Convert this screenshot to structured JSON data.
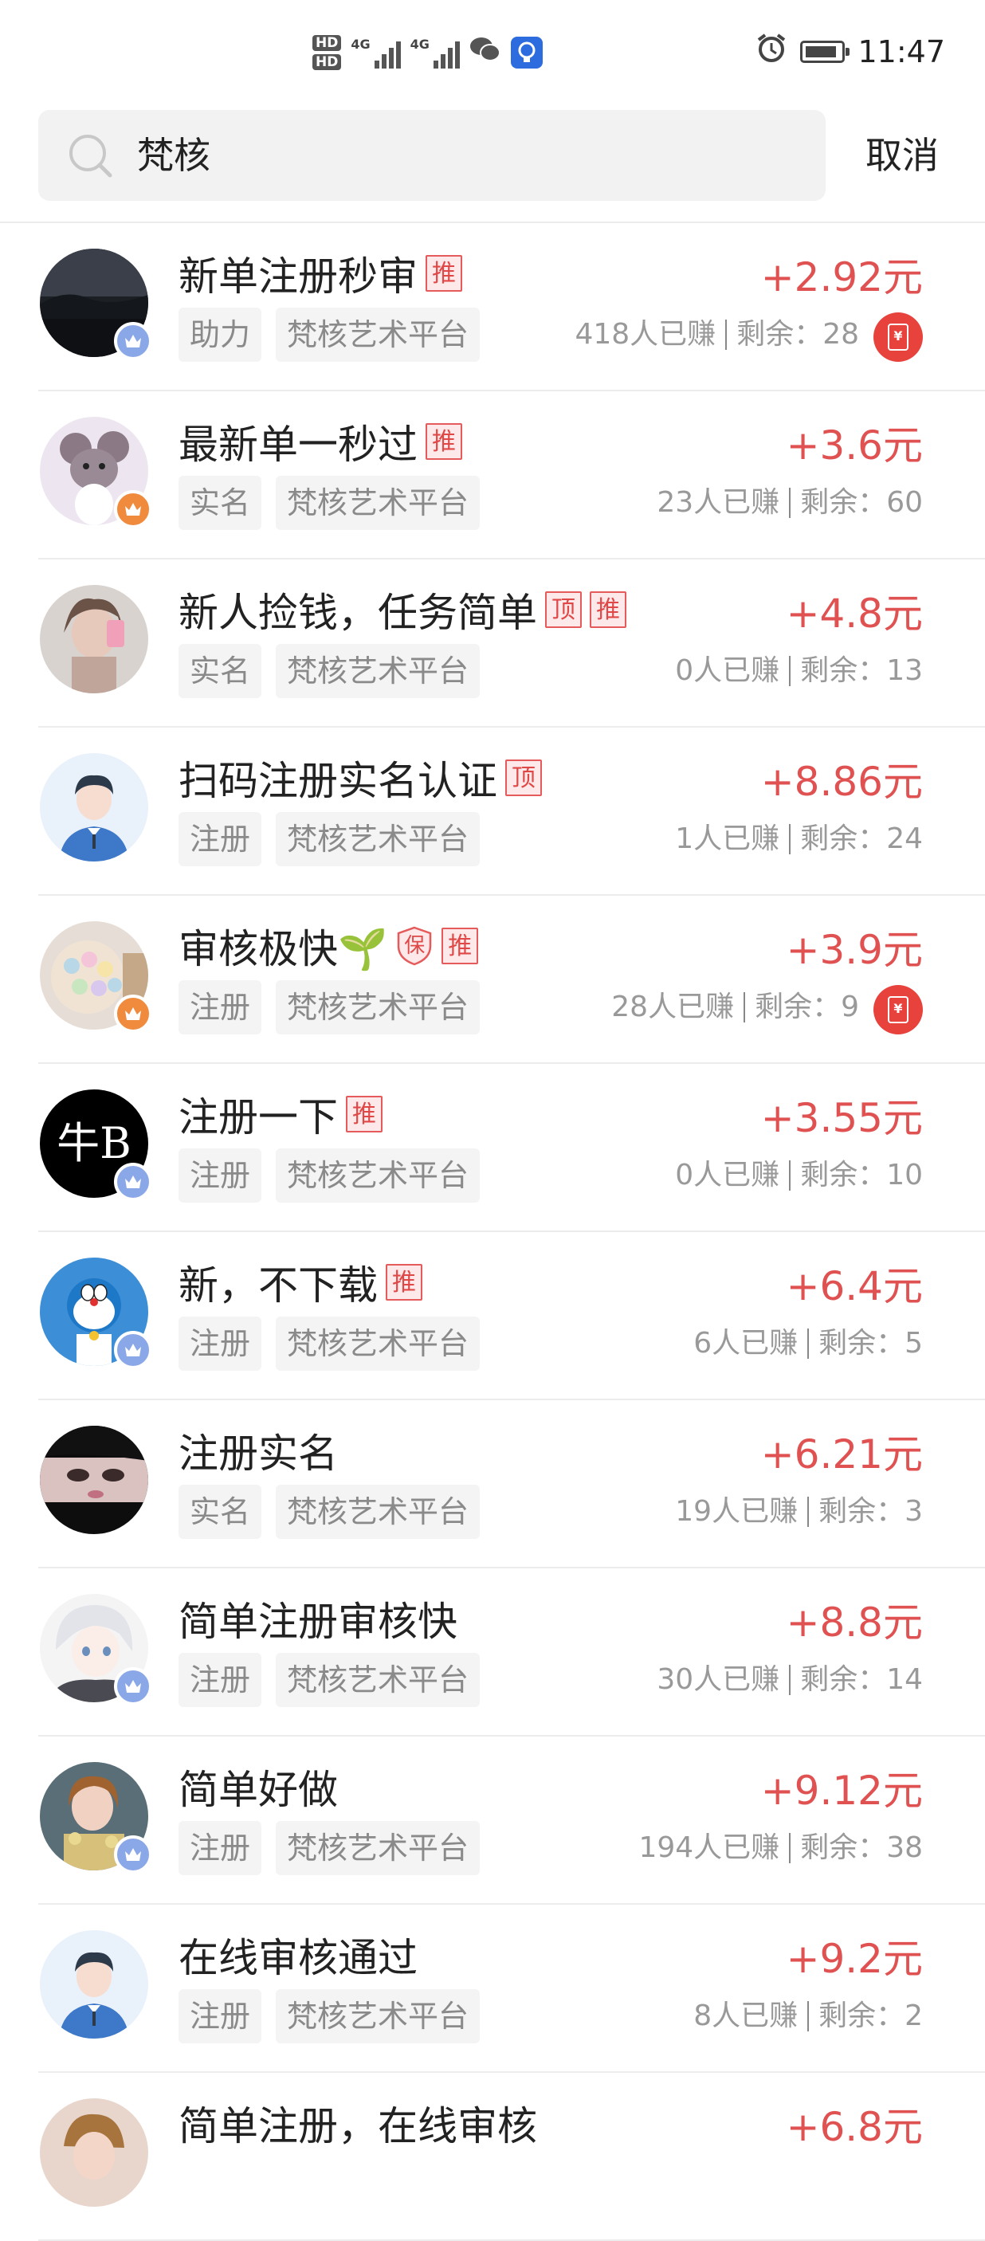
{
  "status_bar": {
    "hd1": "HD",
    "hd2": "HD",
    "net1": "4G",
    "net2": "4G",
    "time": "11:47"
  },
  "search": {
    "query": "梵核",
    "cancel_label": "取消"
  },
  "colors": {
    "price": "#e05252",
    "tag_border": "#e55a5a",
    "badge_blue": "#8aa7e8",
    "badge_orange": "#f08a3c",
    "redpack": "#e8423d"
  },
  "tasks": [
    {
      "title": "新单注册秒审",
      "tags": [
        "推"
      ],
      "category": "助力",
      "platform": "梵核艺术平台",
      "reward": "+2.92元",
      "earned": "418人已赚",
      "remaining": "剩余：28",
      "badge": "blue",
      "redpack": true,
      "avatar": "night-lake"
    },
    {
      "title": "最新单一秒过",
      "tags": [
        "推"
      ],
      "category": "实名",
      "platform": "梵核艺术平台",
      "reward": "+3.6元",
      "earned": "23人已赚",
      "remaining": "剩余：60",
      "badge": "orange",
      "redpack": false,
      "avatar": "cartoon-mouse"
    },
    {
      "title": "新人捡钱，任务简单",
      "tags": [
        "顶",
        "推"
      ],
      "category": "实名",
      "platform": "梵核艺术平台",
      "reward": "+4.8元",
      "earned": "0人已赚",
      "remaining": "剩余：13",
      "badge": "none",
      "redpack": false,
      "avatar": "selfie"
    },
    {
      "title": "扫码注册实名认证",
      "tags": [
        "顶"
      ],
      "category": "注册",
      "platform": "梵核艺术平台",
      "reward": "+8.86元",
      "earned": "1人已赚",
      "remaining": "剩余：24",
      "badge": "none",
      "redpack": false,
      "avatar": "default-user"
    },
    {
      "title": "审核极快🌱",
      "tags": [
        "保",
        "推"
      ],
      "category": "注册",
      "platform": "梵核艺术平台",
      "reward": "+3.9元",
      "earned": "28人已赚",
      "remaining": "剩余：9",
      "badge": "orange",
      "redpack": true,
      "avatar": "candy"
    },
    {
      "title": "注册一下",
      "tags": [
        "推"
      ],
      "category": "注册",
      "platform": "梵核艺术平台",
      "reward": "+3.55元",
      "earned": "0人已赚",
      "remaining": "剩余：10",
      "badge": "blue",
      "redpack": false,
      "avatar": "text-logo",
      "avatar_text": "牛B"
    },
    {
      "title": "新，不下载",
      "tags": [
        "推"
      ],
      "category": "注册",
      "platform": "梵核艺术平台",
      "reward": "+6.4元",
      "earned": "6人已赚",
      "remaining": "剩余：5",
      "badge": "blue",
      "redpack": false,
      "avatar": "doraemon"
    },
    {
      "title": "注册实名",
      "tags": [],
      "category": "实名",
      "platform": "梵核艺术平台",
      "reward": "+6.21元",
      "earned": "19人已赚",
      "remaining": "剩余：3",
      "badge": "none",
      "redpack": false,
      "avatar": "dark-face"
    },
    {
      "title": "简单注册审核快",
      "tags": [],
      "category": "注册",
      "platform": "梵核艺术平台",
      "reward": "+8.8元",
      "earned": "30人已赚",
      "remaining": "剩余：14",
      "badge": "blue",
      "redpack": false,
      "avatar": "anime-boy"
    },
    {
      "title": "简单好做",
      "tags": [],
      "category": "注册",
      "platform": "梵核艺术平台",
      "reward": "+9.12元",
      "earned": "194人已赚",
      "remaining": "剩余：38",
      "badge": "blue",
      "redpack": false,
      "avatar": "girl-flowers"
    },
    {
      "title": "在线审核通过",
      "tags": [],
      "category": "注册",
      "platform": "梵核艺术平台",
      "reward": "+9.2元",
      "earned": "8人已赚",
      "remaining": "剩余：2",
      "badge": "none",
      "redpack": false,
      "avatar": "default-user"
    },
    {
      "title": "简单注册，在线审核",
      "tags": [],
      "category": "",
      "platform": "",
      "reward": "+6.8元",
      "earned": "",
      "remaining": "",
      "badge": "none",
      "redpack": false,
      "avatar": "girl-partial"
    }
  ]
}
